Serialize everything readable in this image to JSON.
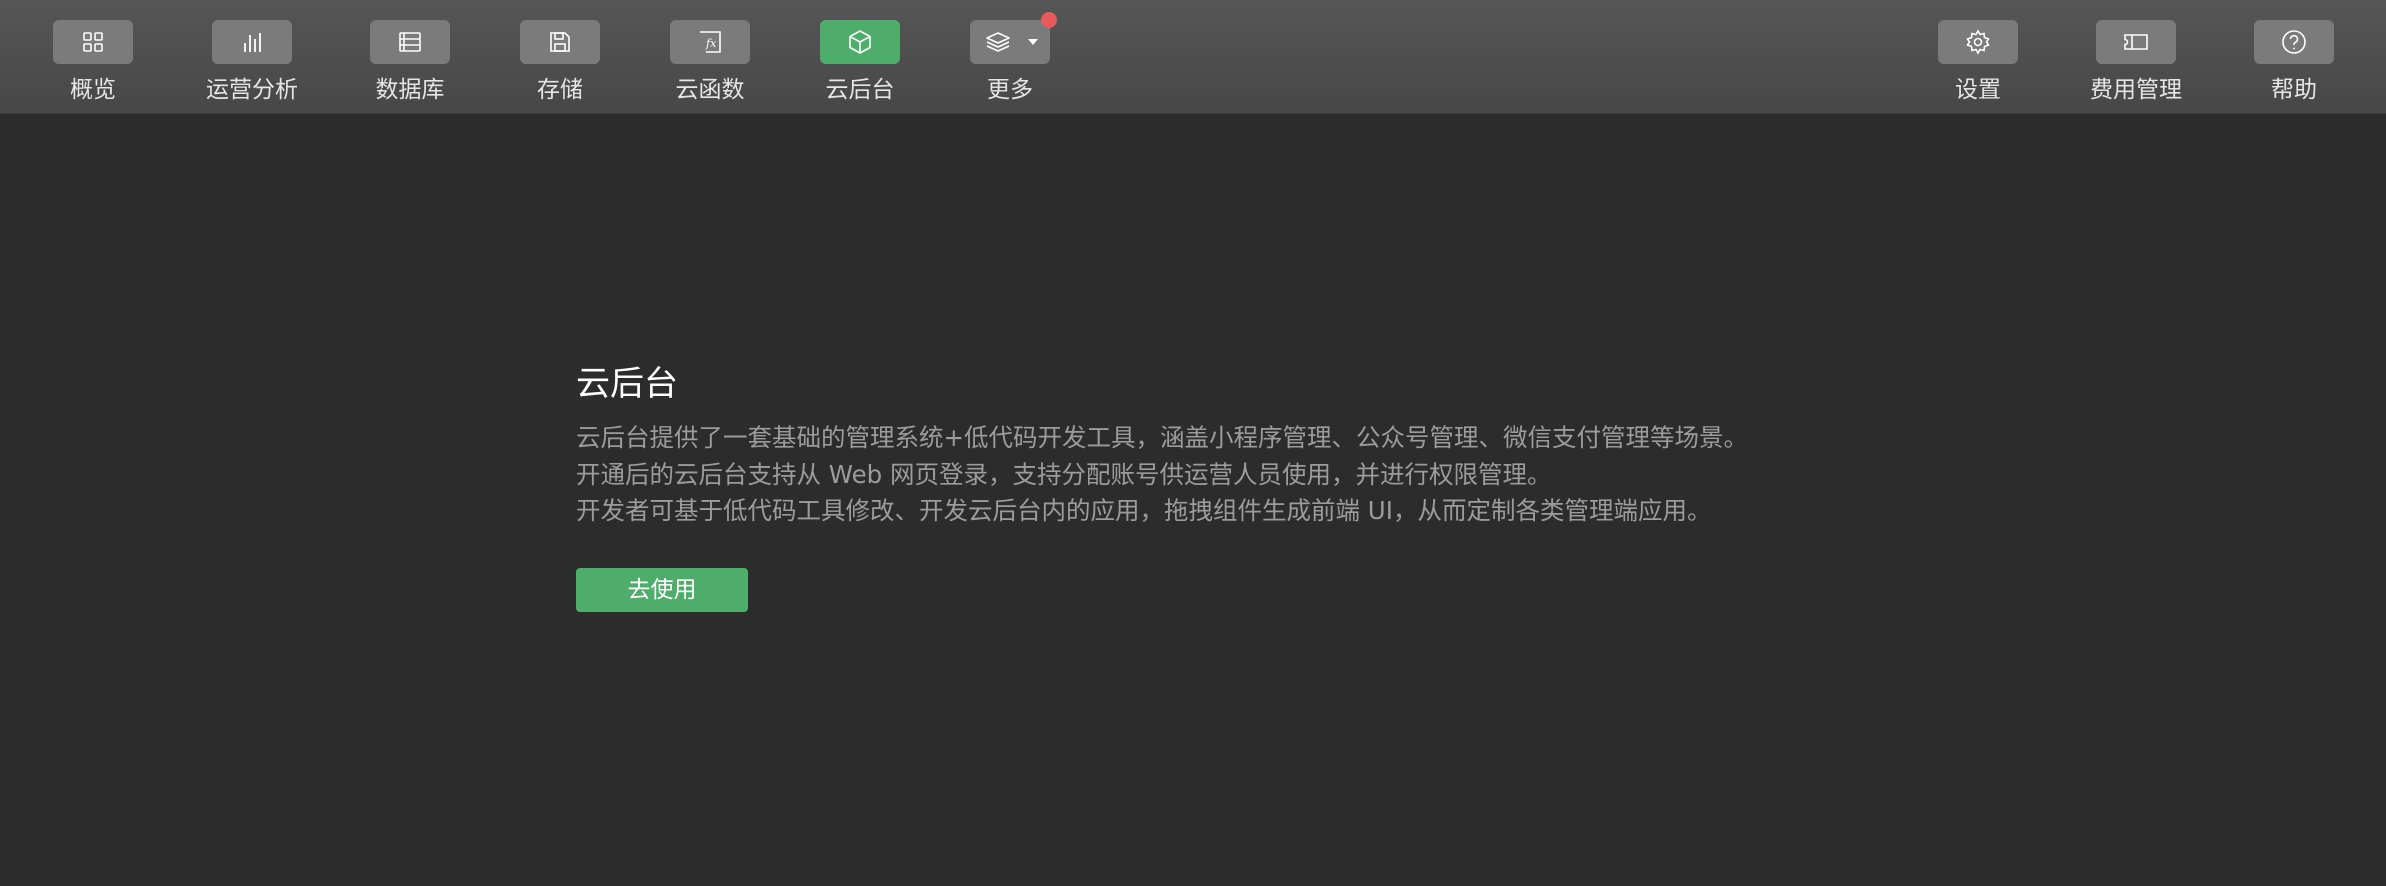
{
  "toolbar": {
    "left_items": [
      {
        "label": "概览",
        "icon": "grid-icon",
        "active": false
      },
      {
        "label": "运营分析",
        "icon": "bar-chart-icon",
        "active": false
      },
      {
        "label": "数据库",
        "icon": "database-icon",
        "active": false
      },
      {
        "label": "存储",
        "icon": "save-icon",
        "active": false
      },
      {
        "label": "云函数",
        "icon": "function-icon",
        "active": false
      },
      {
        "label": "云后台",
        "icon": "cube-icon",
        "active": true
      },
      {
        "label": "更多",
        "icon": "layers-icon",
        "active": false,
        "has_dropdown": true,
        "has_badge": true
      }
    ],
    "right_items": [
      {
        "label": "设置",
        "icon": "gear-icon"
      },
      {
        "label": "费用管理",
        "icon": "ticket-icon"
      },
      {
        "label": "帮助",
        "icon": "help-icon"
      }
    ]
  },
  "main": {
    "title": "云后台",
    "description_lines": [
      "云后台提供了一套基础的管理系统+低代码开发工具，涵盖小程序管理、公众号管理、微信支付管理等场景。",
      "开通后的云后台支持从 Web 网页登录，支持分配账号供运营人员使用，并进行权限管理。",
      "开发者可基于低代码工具修改、开发云后台内的应用，拖拽组件生成前端 UI，从而定制各类管理端应用。"
    ],
    "action_button": "去使用"
  },
  "colors": {
    "accent": "#4ead6b",
    "background": "#2c2c2c",
    "toolbar": "#4e4e4e",
    "badge": "#e85a5a",
    "description_text": "#9c9c9c"
  }
}
